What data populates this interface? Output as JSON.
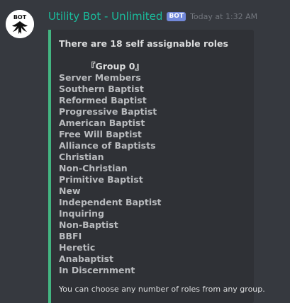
{
  "message": {
    "author": "Utility Bot - Unlimited",
    "bot_tag": "BOT",
    "timestamp": "Today at 1:32 AM",
    "avatar_text": "BOT"
  },
  "embed": {
    "accent_color": "#43b581",
    "title": "There are 18 self assignable roles",
    "group_heading": "『Group 0』",
    "roles": [
      "Server Members",
      "Southern Baptist",
      "Reformed Baptist",
      "Progressive Baptist",
      "American Baptist",
      "Free Will Baptist",
      "Alliance of Baptists",
      "Christian",
      "Non-Christian",
      "Primitive Baptist",
      "New",
      "Independent Baptist",
      "Inquiring",
      "Non-Baptist",
      "BBFI",
      "Heretic",
      "Anabaptist",
      "In Discernment"
    ],
    "footer": "You can choose any number of roles from any group."
  },
  "colors": {
    "background": "#36393f",
    "embed_background": "#2f3136",
    "author": "#1abc9c",
    "bot_tag": "#7289da"
  }
}
